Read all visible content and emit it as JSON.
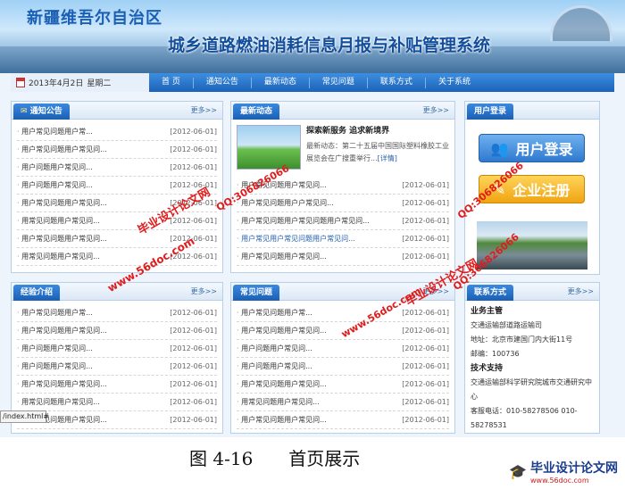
{
  "banner": {
    "region_title": "新疆维吾尔自治区",
    "system_title": "城乡道路燃油消耗信息月报与补贴管理系统"
  },
  "nav": {
    "date": "2013年4月2日",
    "weekday": "星期二",
    "items": [
      "首 页",
      "通知公告",
      "最新动态",
      "常见问题",
      "联系方式",
      "关于系统"
    ]
  },
  "notice": {
    "title": "通知公告",
    "more": "更多>>",
    "rows": [
      {
        "t": "用户常见问题用户常...",
        "d": "[2012-06-01]"
      },
      {
        "t": "用户常见问题用户常见问...",
        "d": "[2012-06-01]"
      },
      {
        "t": "用户问题用户常见问...",
        "d": "[2012-06-01]"
      },
      {
        "t": "用户问题用户常见问...",
        "d": "[2012-06-01]"
      },
      {
        "t": "用户常见问题用户常见问...",
        "d": "[2012-06-01]"
      },
      {
        "t": "用常见问题用户常见问...",
        "d": "[2012-06-01]"
      },
      {
        "t": "用户常见问题用户常见问...",
        "d": "[2012-06-01]"
      },
      {
        "t": "用常见问题用户常见问...",
        "d": "[2012-06-01]"
      }
    ]
  },
  "news": {
    "title": "最新动态",
    "more": "更多>>",
    "headline": "探索新服务 追求新境界",
    "summary": "最新动态：第二十五届中国国际塑料橡胶工业展览会在广搜重举行...",
    "detail_link": "[详情]",
    "rows": [
      {
        "t": "用户常见问题用户常见问...",
        "d": "[2012-06-01]"
      },
      {
        "t": "用户常见问题用户户常见问...",
        "d": "[2012-06-01]"
      },
      {
        "t": "用户常见问题用户常见问题用户常见问...",
        "d": "[2012-06-01]"
      },
      {
        "t": "用户常见用户常见问题用户常见问...",
        "d": "[2012-06-01]"
      },
      {
        "t": "用户常见问题用户常见问...",
        "d": "[2012-06-01]"
      }
    ]
  },
  "login": {
    "title": "用户登录",
    "login_label": "用户登录",
    "register_label": "企业注册"
  },
  "experience": {
    "title": "经验介绍",
    "more": "更多>>",
    "rows": [
      {
        "t": "用户常见问题用户常...",
        "d": "[2012-06-01]"
      },
      {
        "t": "用户常见问题用户常见问...",
        "d": "[2012-06-01]"
      },
      {
        "t": "用户问题用户常见问...",
        "d": "[2012-06-01]"
      },
      {
        "t": "用户问题用户常见问...",
        "d": "[2012-06-01]"
      },
      {
        "t": "用户常见问题用户常见问...",
        "d": "[2012-06-01]"
      },
      {
        "t": "用常见问题用户常见问...",
        "d": "[2012-06-01]"
      },
      {
        "t": "用户常见问题用户常见问...",
        "d": "[2012-06-01]"
      }
    ]
  },
  "faq": {
    "title": "常见问题",
    "more": "更多>>",
    "rows": [
      {
        "t": "用户常见问题用户常...",
        "d": "[2012-06-01]"
      },
      {
        "t": "用户常见问题用户常见问...",
        "d": "[2012-06-01]"
      },
      {
        "t": "用户问题用户常见问...",
        "d": "[2012-06-01]"
      },
      {
        "t": "用户问题用户常见问...",
        "d": "[2012-06-01]"
      },
      {
        "t": "用户常见问题用户常见问...",
        "d": "[2012-06-01]"
      },
      {
        "t": "用常见问题用户常见问...",
        "d": "[2012-06-01]"
      },
      {
        "t": "用户常见问题用户常见问...",
        "d": "[2012-06-01]"
      }
    ]
  },
  "contact": {
    "title": "联系方式",
    "more": "更多>>",
    "dept1": "业务主管",
    "dept1_name": "交通运输部道路运输司",
    "address": "地址：北京市建国门内大街11号",
    "postcode": "邮编：100736",
    "dept2": "技术支持",
    "dept2_name": "交通运输部科学研究院城市交通研究中心",
    "phone": "客服电话：010-58278506 010-58278531"
  },
  "status_url": "/index.html#",
  "watermark": {
    "site": "毕业设计论文网",
    "url": "www.56doc.com",
    "qq": "QQ:306826066"
  },
  "caption": "图 4-16　　首页展示",
  "footer": {
    "name": "毕业设计论文网",
    "url": "www.56doc.com"
  }
}
